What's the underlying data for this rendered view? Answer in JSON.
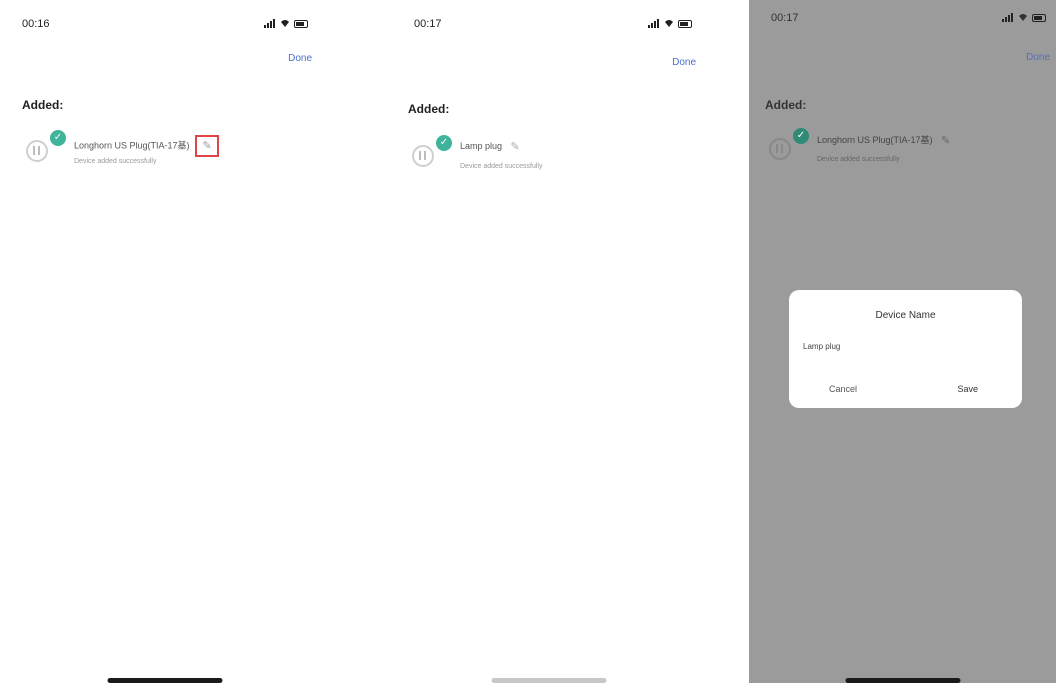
{
  "screens": [
    {
      "time": "00:16",
      "done": "Done",
      "added_label": "Added:",
      "device_name": "Longhorn US Plug(TIA-17基)",
      "device_status": "Device added successfully",
      "pencil_highlighted": true
    },
    {
      "time": "00:17",
      "done": "Done",
      "added_label": "Added:",
      "device_name": "Lamp plug",
      "device_status": "Device added successfully",
      "pencil_highlighted": false
    },
    {
      "time": "00:17",
      "done": "Done",
      "added_label": "Added:",
      "device_name": "Longhorn US Plug(TIA-17基)",
      "device_status": "Device added successfully",
      "dialog": {
        "title": "Device Name",
        "input_value": "Lamp plug",
        "cancel": "Cancel",
        "save": "Save"
      }
    }
  ],
  "colors": {
    "accent": "#4a6fd1",
    "check": "#3fb49b",
    "highlight": "#e04444",
    "overlay": "#9b9b9b"
  }
}
